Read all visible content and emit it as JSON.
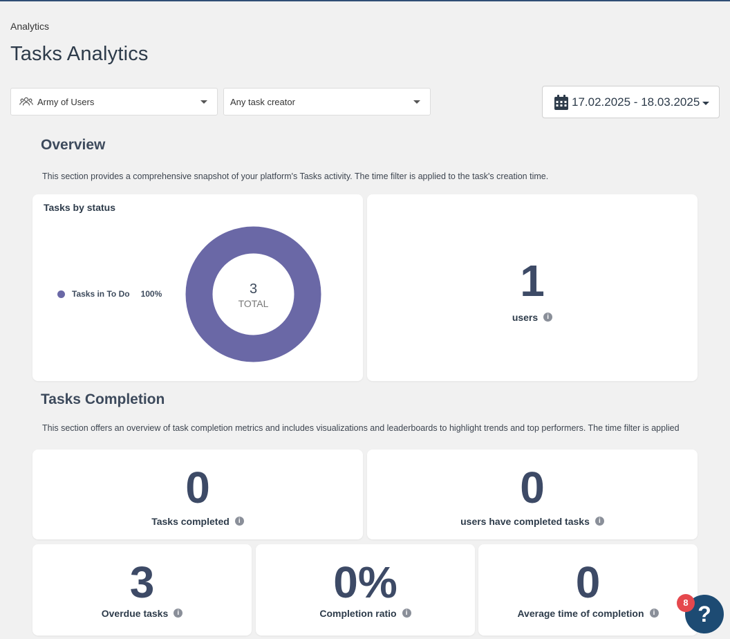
{
  "breadcrumb": "Analytics",
  "page_title": "Tasks Analytics",
  "filters": {
    "users_select": "Army of Users",
    "creator_select": "Any task creator",
    "date_range": "17.02.2025 - 18.03.2025"
  },
  "overview": {
    "title": "Overview",
    "description": "This section provides a comprehensive snapshot of your platform's Tasks activity. The time filter is applied to the task's creation time.",
    "status_card": {
      "title": "Tasks by status",
      "legend_label": "Tasks in To Do",
      "legend_percent": "100%",
      "total_value": "3",
      "total_label": "TOTAL",
      "color": "#6a68a6"
    },
    "users_card": {
      "value": "1",
      "label": "users"
    }
  },
  "completion": {
    "title": "Tasks Completion",
    "description": "This section offers an overview of task completion metrics and includes visualizations and leaderboards to highlight trends and top performers. The time filter is applied",
    "tasks_completed": {
      "value": "0",
      "label": "Tasks completed"
    },
    "users_completed": {
      "value": "0",
      "label": "users have completed tasks"
    },
    "overdue": {
      "value": "3",
      "label": "Overdue tasks"
    },
    "ratio": {
      "value": "0%",
      "label": "Completion ratio"
    },
    "avg_time": {
      "value": "0",
      "label": "Average time of completion"
    }
  },
  "help": {
    "badge_count": "8",
    "icon_text": "?"
  },
  "colors": {
    "accent": "#1d4b73",
    "badge": "#e5484d",
    "donut": "#6a68a6"
  }
}
